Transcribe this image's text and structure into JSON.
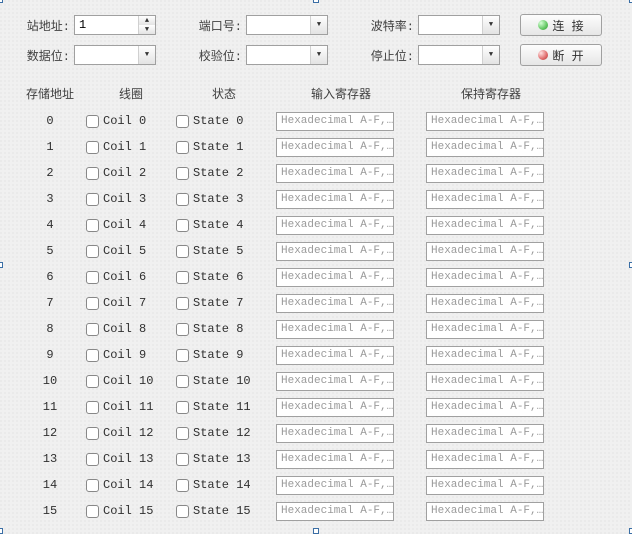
{
  "form": {
    "station_addr_label": "站地址:",
    "station_addr_value": "1",
    "port_label": "端口号:",
    "port_value": "",
    "baud_label": "波特率:",
    "baud_value": "",
    "data_bits_label": "数据位:",
    "data_bits_value": "",
    "parity_label": "校验位:",
    "parity_value": "",
    "stop_bits_label": "停止位:",
    "stop_bits_value": "",
    "connect_label": "连 接",
    "disconnect_label": "断 开"
  },
  "headers": {
    "addr": "存储地址",
    "coil": "线圈",
    "state": "状态",
    "input_reg": "输入寄存器",
    "holding_reg": "保持寄存器"
  },
  "register_placeholder": "Hexadecimal A-F,…",
  "rows": [
    {
      "addr": "0",
      "coil": "Coil 0",
      "state": "State 0"
    },
    {
      "addr": "1",
      "coil": "Coil 1",
      "state": "State 1"
    },
    {
      "addr": "2",
      "coil": "Coil 2",
      "state": "State 2"
    },
    {
      "addr": "3",
      "coil": "Coil 3",
      "state": "State 3"
    },
    {
      "addr": "4",
      "coil": "Coil 4",
      "state": "State 4"
    },
    {
      "addr": "5",
      "coil": "Coil 5",
      "state": "State 5"
    },
    {
      "addr": "6",
      "coil": "Coil 6",
      "state": "State 6"
    },
    {
      "addr": "7",
      "coil": "Coil 7",
      "state": "State 7"
    },
    {
      "addr": "8",
      "coil": "Coil 8",
      "state": "State 8"
    },
    {
      "addr": "9",
      "coil": "Coil 9",
      "state": "State 9"
    },
    {
      "addr": "10",
      "coil": "Coil 10",
      "state": "State 10"
    },
    {
      "addr": "11",
      "coil": "Coil 11",
      "state": "State 11"
    },
    {
      "addr": "12",
      "coil": "Coil 12",
      "state": "State 12"
    },
    {
      "addr": "13",
      "coil": "Coil 13",
      "state": "State 13"
    },
    {
      "addr": "14",
      "coil": "Coil 14",
      "state": "State 14"
    },
    {
      "addr": "15",
      "coil": "Coil 15",
      "state": "State 15"
    }
  ]
}
